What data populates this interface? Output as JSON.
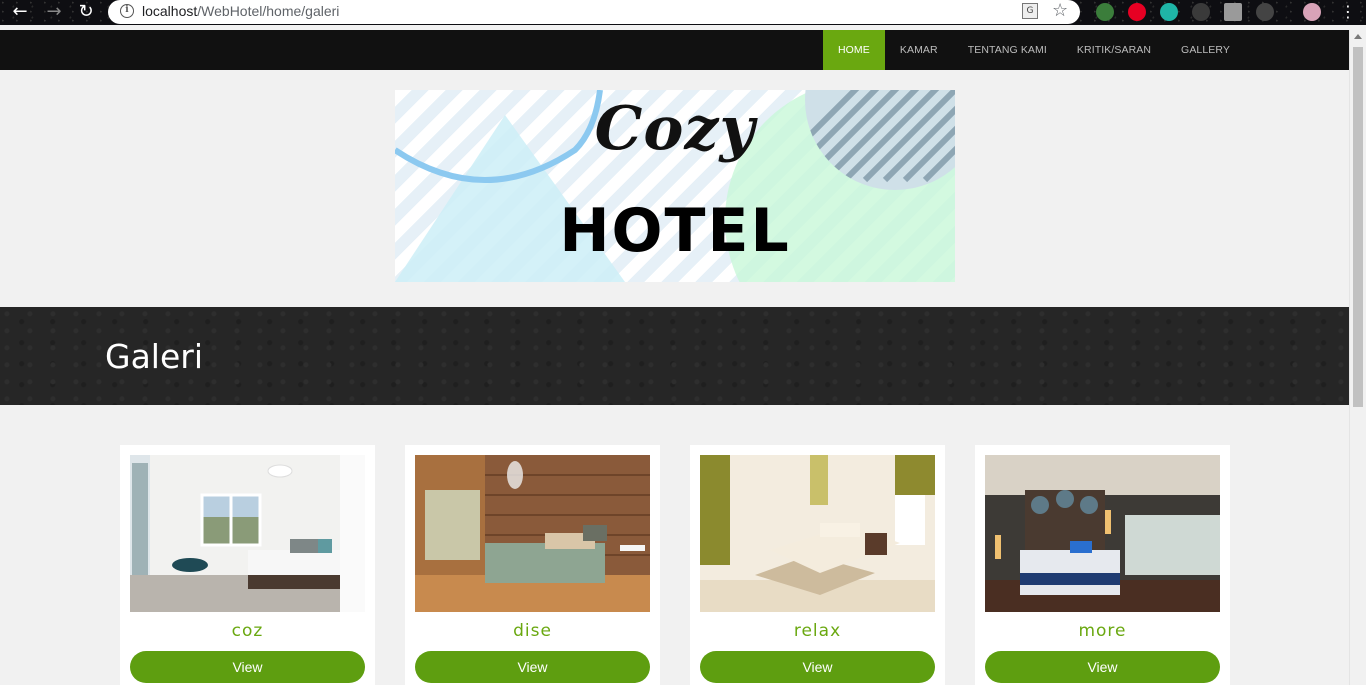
{
  "browser": {
    "url_host": "localhost",
    "url_path": "/WebHotel/home/galeri"
  },
  "nav": {
    "items": [
      {
        "label": "HOME",
        "active": true
      },
      {
        "label": "KAMAR",
        "active": false
      },
      {
        "label": "TENTANG KAMI",
        "active": false
      },
      {
        "label": "KRITIK/SARAN",
        "active": false
      },
      {
        "label": "GALLERY",
        "active": false
      }
    ]
  },
  "logo": {
    "line1": "Cozy",
    "line2": "HOTEL"
  },
  "page": {
    "title": "Galeri"
  },
  "gallery": [
    {
      "caption": "coz",
      "button": "View"
    },
    {
      "caption": "dise",
      "button": "View"
    },
    {
      "caption": "relax",
      "button": "View"
    },
    {
      "caption": "more",
      "button": "View"
    }
  ],
  "colors": {
    "accent": "#6aa810",
    "button": "#5e9e10",
    "nav_bg": "#111111",
    "banner_bg": "#262626"
  }
}
